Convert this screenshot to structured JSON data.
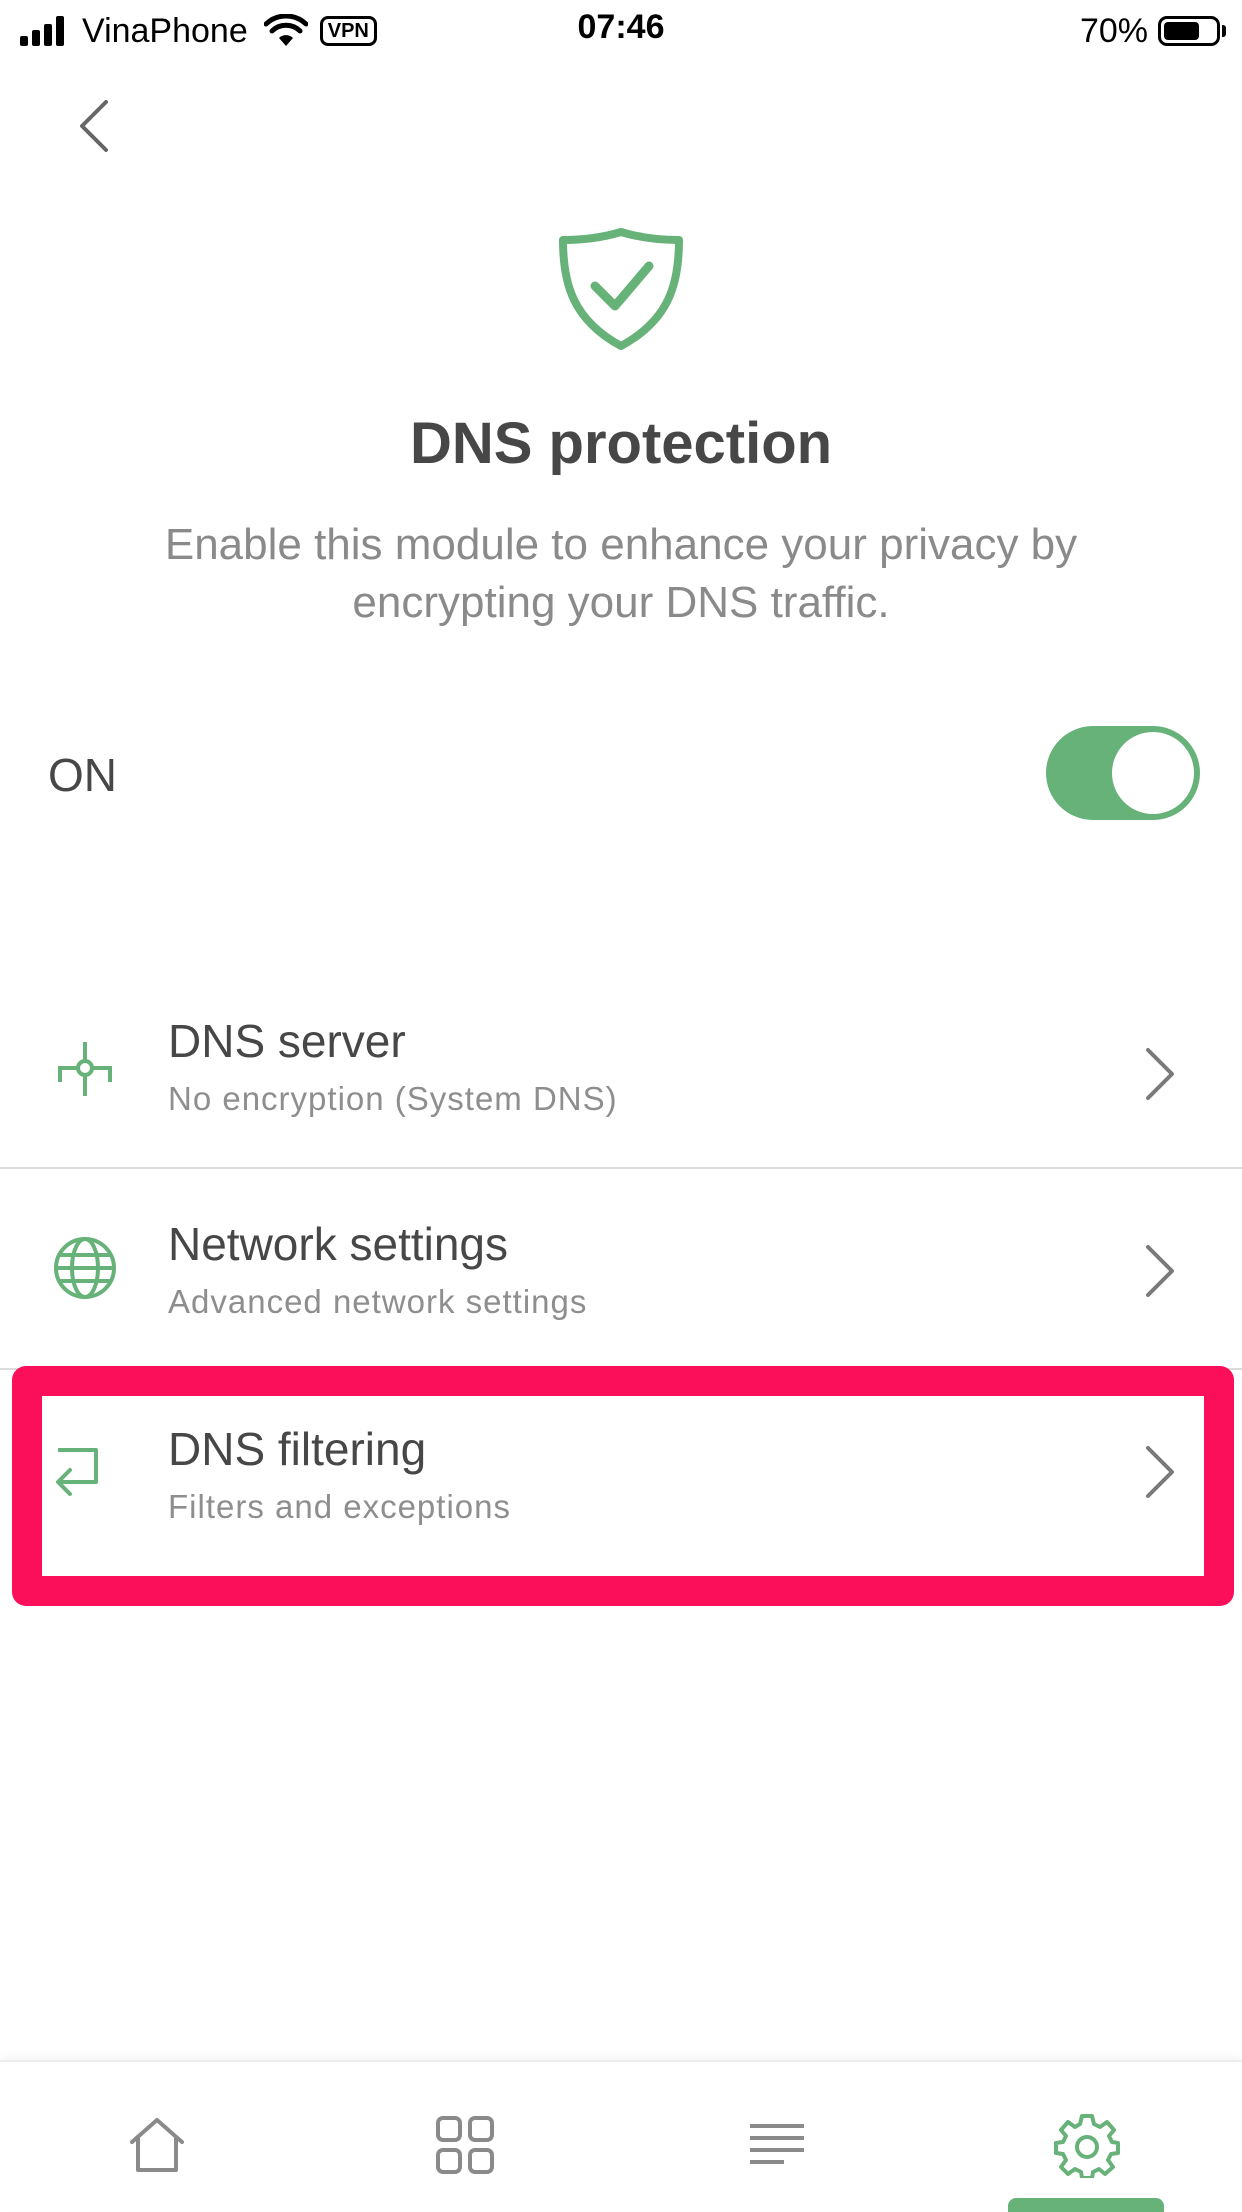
{
  "status_bar": {
    "carrier": "VinaPhone",
    "vpn_label": "VPN",
    "time": "07:46",
    "battery_percent": "70%",
    "battery_level": 0.7
  },
  "header": {
    "back_icon": "chevron-left-icon",
    "hero_icon": "shield-check-icon",
    "title": "DNS protection",
    "description": "Enable this module to enhance your privacy by encrypting your DNS traffic."
  },
  "toggle": {
    "label": "ON",
    "state": true
  },
  "settings": {
    "items": [
      {
        "icon": "dns-server-icon",
        "title": "DNS server",
        "subtitle": "No encryption (System DNS)"
      },
      {
        "icon": "globe-icon",
        "title": "Network settings",
        "subtitle": "Advanced network settings"
      },
      {
        "icon": "return-arrow-icon",
        "title": "DNS filtering",
        "subtitle": "Filters and exceptions"
      }
    ]
  },
  "tabbar": {
    "tabs": [
      {
        "icon": "home-icon"
      },
      {
        "icon": "grid-icon"
      },
      {
        "icon": "activity-list-icon"
      },
      {
        "icon": "gear-icon"
      }
    ],
    "active_index": 3
  },
  "colors": {
    "accent": "#67b279",
    "highlight": "#fb0f5a",
    "text_primary": "#474747",
    "text_secondary": "#8a8a8a"
  }
}
